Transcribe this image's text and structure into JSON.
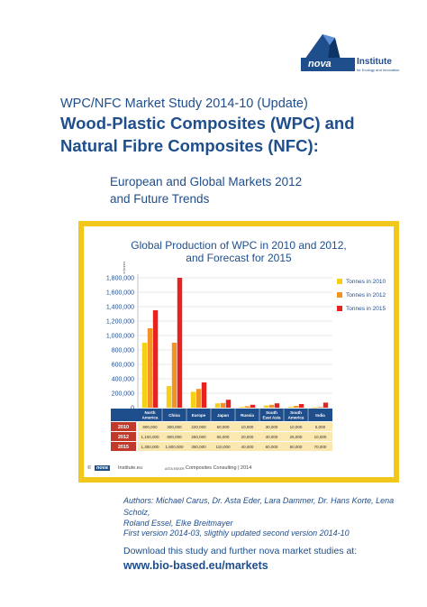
{
  "logo": {
    "word": "nova",
    "institute": "Institute",
    "tagline": "for Ecology and Innovation"
  },
  "header": {
    "study": "WPC/NFC Market Study 2014-10 (Update)",
    "title_line1": "Wood-Plastic Composites (WPC) and",
    "title_line2": "Natural Fibre Composites (NFC):",
    "subtitle_line1": "European and Global Markets 2012",
    "subtitle_line2": "and Future Trends"
  },
  "chart_data": {
    "type": "bar",
    "title_line1": "Global Production of WPC in 2010 and 2012,",
    "title_line2": "and Forecast for 2015",
    "ylabel": "in tonnes",
    "ylim": [
      0,
      1800000
    ],
    "yticks": [
      "1,800,000",
      "1,600,000",
      "1,400,000",
      "1,200,000",
      "1,000,000",
      "800,000",
      "600,000",
      "400,000",
      "200,000",
      "0"
    ],
    "categories": [
      "North America",
      "China",
      "Europe",
      "Japan",
      "Russia",
      "South East Asia",
      "South America",
      "India"
    ],
    "category_labels": [
      [
        "North",
        "America"
      ],
      [
        "China"
      ],
      [
        "Europe"
      ],
      [
        "Japan"
      ],
      [
        "Russia"
      ],
      [
        "South",
        "East Asia"
      ],
      [
        "South",
        "America"
      ],
      [
        "India"
      ]
    ],
    "series": [
      {
        "name": "Tonnes in 2010",
        "row_label": "2010",
        "color": "#f5d017",
        "values": [
          900000,
          300000,
          220000,
          60000,
          10000,
          30000,
          10000,
          5000
        ],
        "labels": [
          "900,000",
          "300,000",
          "220,000",
          "60,000",
          "10,000",
          "30,000",
          "10,000",
          "5,000"
        ]
      },
      {
        "name": "Tonnes in 2012",
        "row_label": "2012",
        "color": "#f39325",
        "values": [
          1100000,
          900000,
          260000,
          65000,
          20000,
          40000,
          25000,
          10000
        ],
        "labels": [
          "1,100,000",
          "900,000",
          "260,000",
          "65,000",
          "20,000",
          "40,000",
          "25,000",
          "10,000"
        ]
      },
      {
        "name": "Tonnes in 2015",
        "row_label": "2015",
        "color": "#e52421",
        "values": [
          1350000,
          1800000,
          350000,
          110000,
          40000,
          60000,
          50000,
          70000
        ],
        "labels": [
          "1,350,000",
          "1,800,000",
          "350,000",
          "110,000",
          "40,000",
          "60,000",
          "50,000",
          "70,000"
        ]
      }
    ],
    "colors": {
      "axis_header": "#1f4e8c",
      "row_header": "#c0392b",
      "row_bg": "#fbe7b0"
    }
  },
  "chart_footer": {
    "nova": "nova",
    "domain": "Institute.eu",
    "partner": "ASTA ESKER",
    "consult": "Composites Consulting | 2014"
  },
  "credits": {
    "authors_line1": "Authors: Michael Carus, Dr. Asta Eder, Lara Dammer, Dr. Hans Korte, Lena Scholz,",
    "authors_line2": "Roland Essel, Elke Breitmayer",
    "version": "First version 2014-03, sligthly updated second version 2014-10",
    "download": "Download this study and further nova market studies at:",
    "url": "www.bio-based.eu/markets"
  }
}
